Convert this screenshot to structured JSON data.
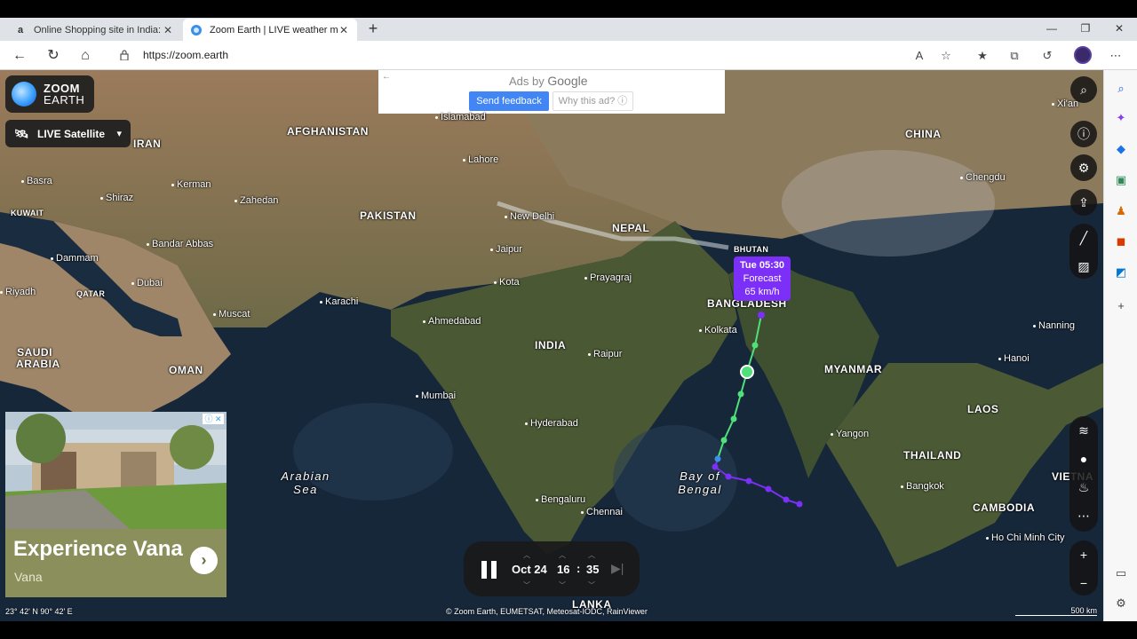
{
  "browser": {
    "tabs": [
      {
        "title": "Online Shopping site in India: Sh",
        "favicon": "amazon-icon",
        "active": false
      },
      {
        "title": "Zoom Earth | LIVE weather map",
        "favicon": "zoom-earth-icon",
        "active": true
      }
    ],
    "url": "https://zoom.earth"
  },
  "app": {
    "logo_line1": "ZOOM",
    "logo_line2": "EARTH",
    "layer_label": "LIVE Satellite"
  },
  "ad_banner": {
    "ads_by": "Ads by",
    "google": "Google",
    "send_feedback": "Send feedback",
    "why_ad": "Why this ad? ⓘ"
  },
  "map_labels": {
    "countries": [
      "IRAN",
      "AFGHANISTAN",
      "PAKISTAN",
      "NEPAL",
      "CHINA",
      "INDIA",
      "BHUTAN",
      "BANGLADESH",
      "MYANMAR",
      "OMAN",
      "SAUDI ARABIA",
      "QATAR",
      "KUWAIT",
      "LAOS",
      "THAILAND",
      "CAMBODIA",
      "VIETNA",
      "LANKA"
    ],
    "cities": [
      "Islamabad",
      "Lahore",
      "New Delhi",
      "Jaipur",
      "Kota",
      "Prayagraj",
      "Ahmedabad",
      "Karachi",
      "Kolkata",
      "Raipur",
      "Mumbai",
      "Hyderabad",
      "Bengaluru",
      "Chennai",
      "Basra",
      "Shiraz",
      "Kerman",
      "Zahedan",
      "Bandar Abbas",
      "Dammam",
      "Dubai",
      "Muscat",
      "Riyadh",
      "Chengdu",
      "Xi'an",
      "Nanning",
      "Hanoi",
      "Yangon",
      "Bangkok",
      "Ho Chi Minh City"
    ],
    "seas": [
      "Arabian Sea",
      "Bay of Bengal"
    ]
  },
  "forecast_tooltip": {
    "time": "Tue 05:30",
    "label": "Forecast",
    "speed": "65 km/h"
  },
  "player": {
    "date": "Oct 24",
    "hour": "16",
    "separator": ":",
    "minute": "35"
  },
  "side_ad": {
    "headline": "Experience Vana",
    "brand": "Vana"
  },
  "footer": {
    "coordinates": "23° 42' N  90° 42' E",
    "attribution": "© Zoom Earth, EUMETSAT, Meteosat-IODC, RainViewer",
    "scale": "500 km"
  }
}
